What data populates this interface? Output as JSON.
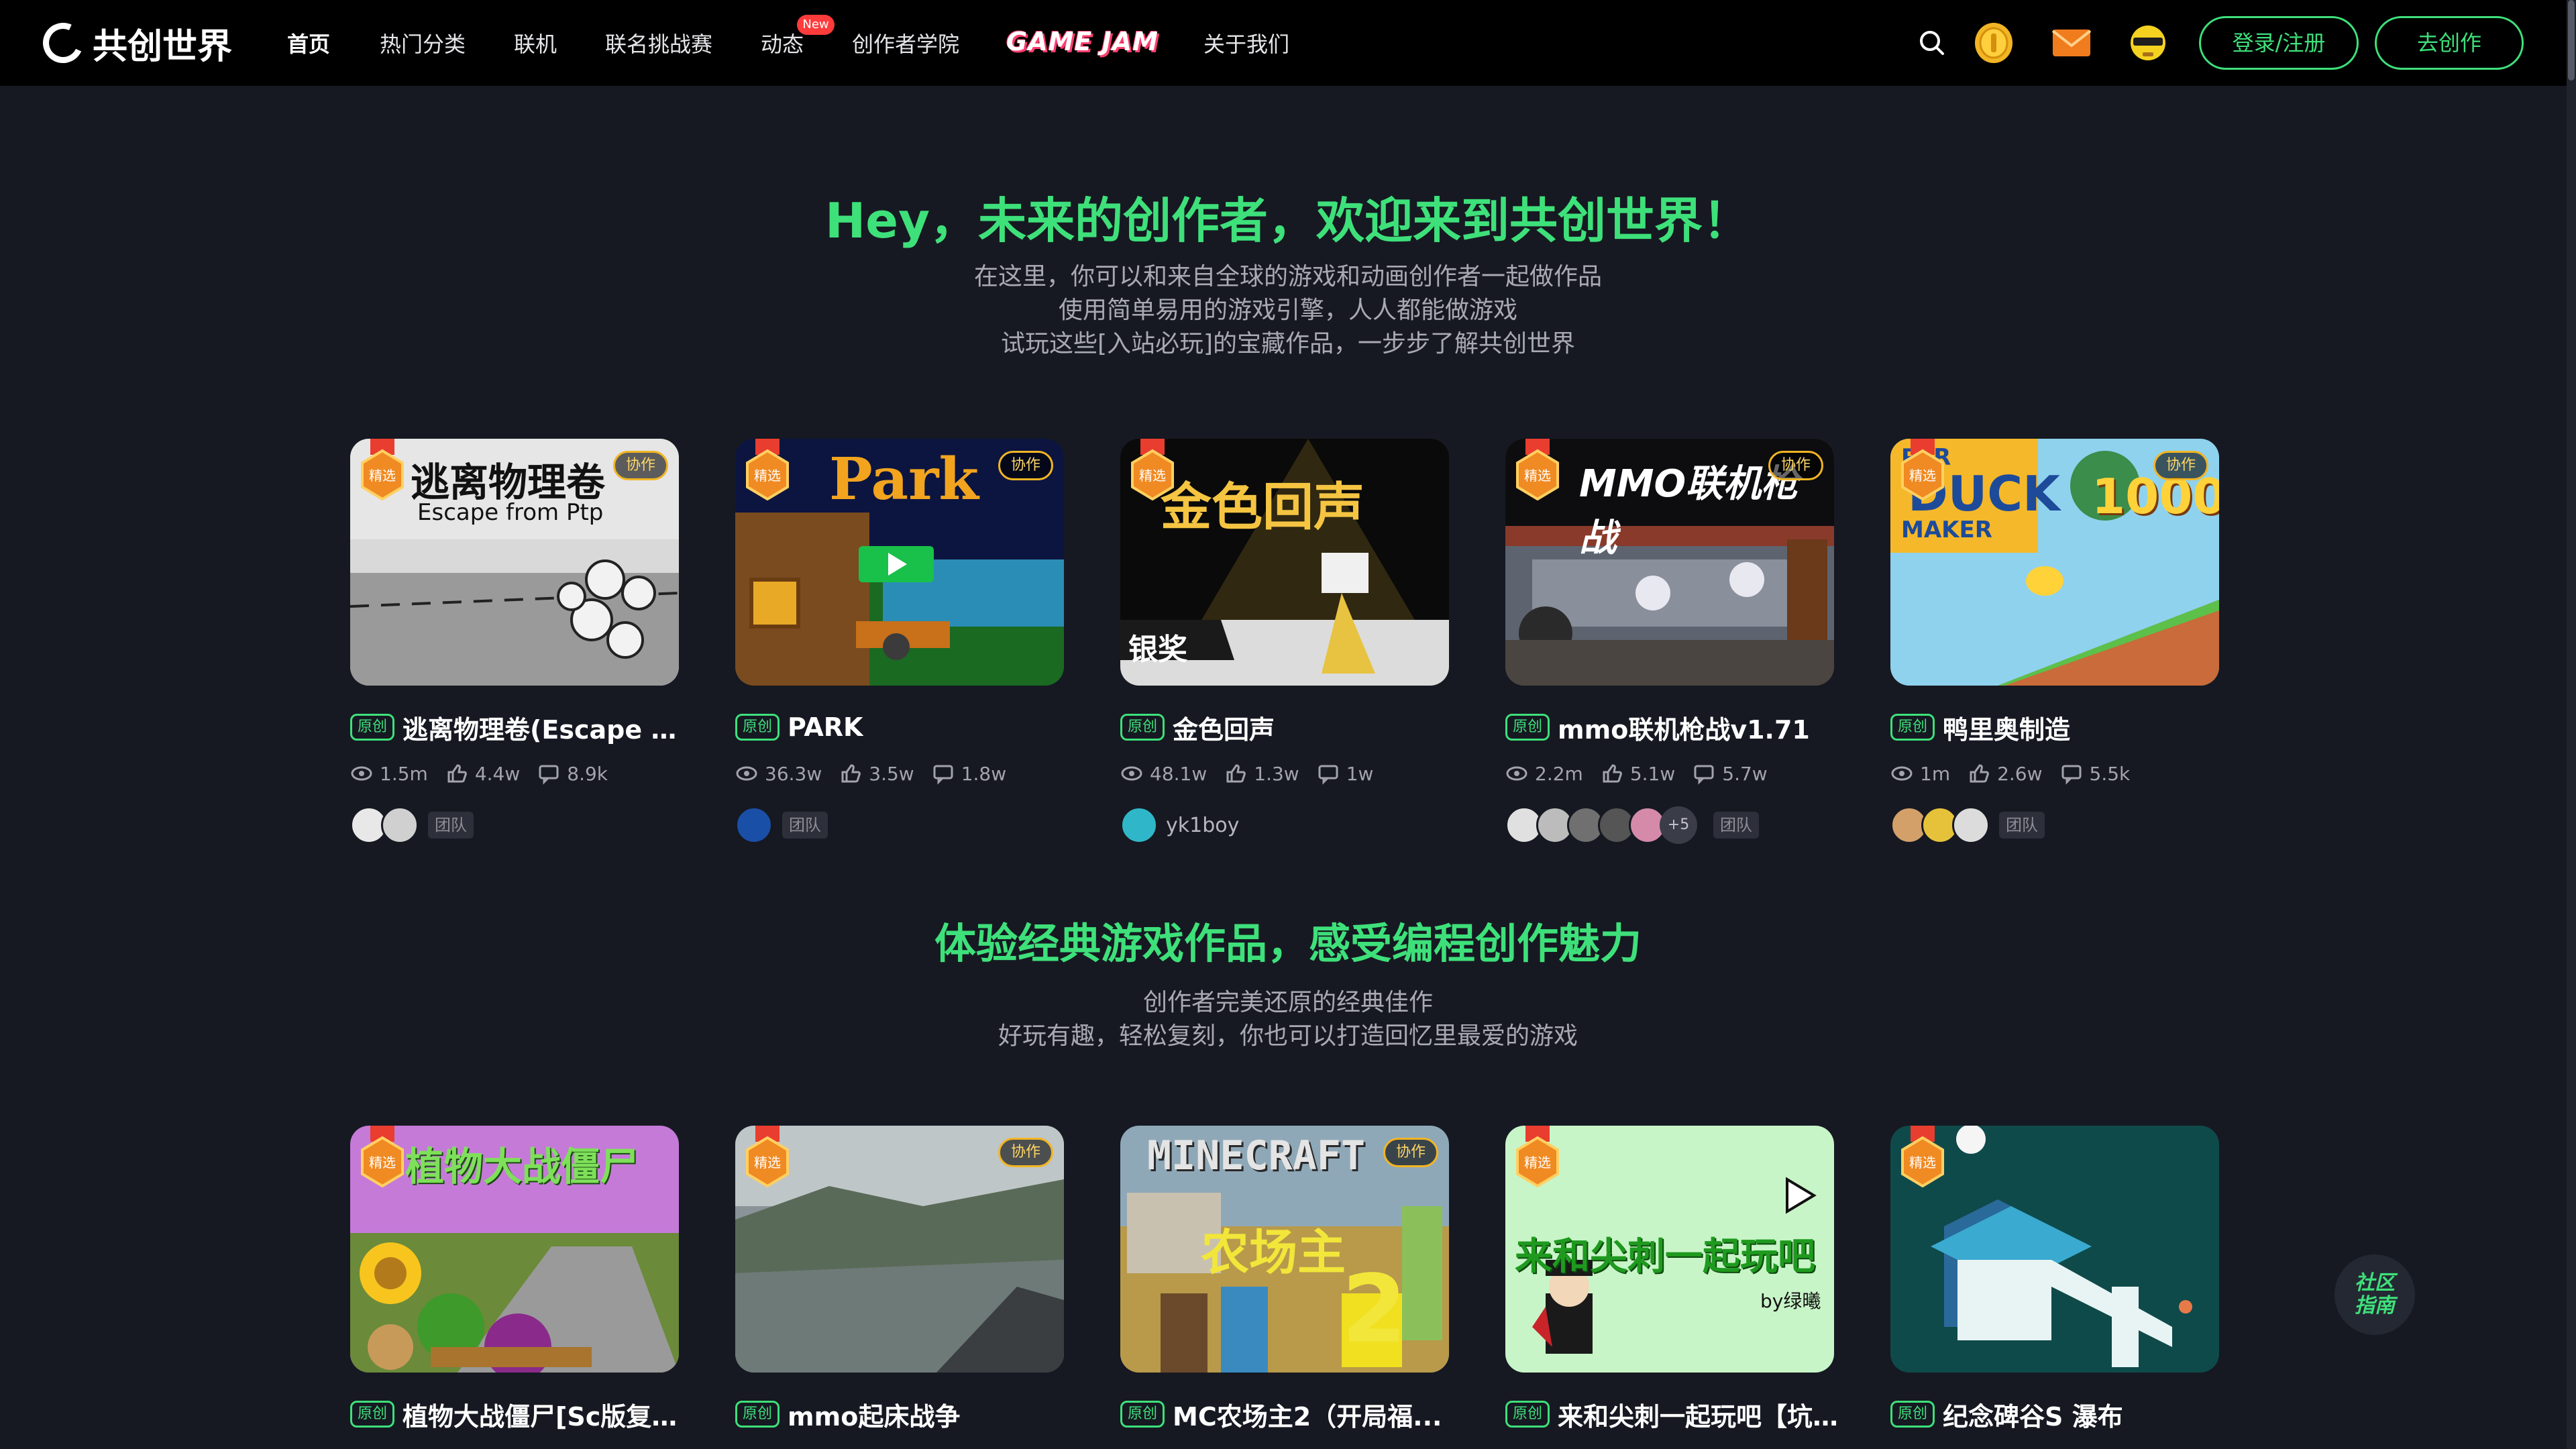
{
  "brand": {
    "logo_text": "共创世界"
  },
  "nav": {
    "items": [
      "首页",
      "热门分类",
      "联机",
      "联名挑战赛",
      "动态",
      "创作者学院",
      "关于我们"
    ],
    "new_badge": "New",
    "gamejam": "GAME JAM",
    "login_label": "登录/注册",
    "create_label": "去创作"
  },
  "hero": {
    "title": "Hey，未来的创作者，欢迎来到共创世界！",
    "lines": [
      "在这里，你可以和来自全球的游戏和动画创作者一起做作品",
      "使用简单易用的游戏引擎，人人都能做游戏",
      "试玩这些[入站必玩]的宝藏作品，一步步了解共创世界"
    ]
  },
  "row1": [
    {
      "title": "逃离物理卷(Escape fr...",
      "tag": "原创",
      "featured": true,
      "coop": "协作",
      "views": "1.5m",
      "likes": "4.4w",
      "comments": "8.9k",
      "team": "团队",
      "thumb_title": "逃离物理卷",
      "thumb_sub": "Escape from Ptp"
    },
    {
      "title": "PARK",
      "tag": "原创",
      "featured": true,
      "coop": "协作",
      "views": "36.3w",
      "likes": "3.5w",
      "comments": "1.8w",
      "team": "团队",
      "thumb_title": "Park"
    },
    {
      "title": "金色回声",
      "tag": "原创",
      "featured": true,
      "views": "48.1w",
      "likes": "1.3w",
      "comments": "1w",
      "author": "yk1boy",
      "thumb_title": "金色回声",
      "thumb_award": "银奖"
    },
    {
      "title": "mmo联机枪战v1.71",
      "tag": "原创",
      "featured": true,
      "coop": "协作",
      "views": "2.2m",
      "likes": "5.1w",
      "comments": "5.7w",
      "team": "团队",
      "more": "+5",
      "thumb_title": "MMO联机枪战"
    },
    {
      "title": "鸭里奥制造",
      "tag": "原创",
      "featured": true,
      "coop": "协作",
      "views": "1m",
      "likes": "2.6w",
      "comments": "5.5k",
      "team": "团队",
      "thumb_title": "DUCK",
      "thumb_top": "PER",
      "thumb_bottom": "MAKER",
      "thumb_number": "1000"
    }
  ],
  "section2": {
    "title": "体验经典游戏作品，感受编程创作魅力",
    "lines": [
      "创作者完美还原的经典佳作",
      "好玩有趣，轻松复刻，你也可以打造回忆里最爱的游戏"
    ]
  },
  "row2": [
    {
      "title": "植物大战僵尸[Sc版复刻]",
      "tag": "原创",
      "featured": true,
      "thumb_title": "植物大战僵尸"
    },
    {
      "title": "mmo起床战争",
      "tag": "原创",
      "featured": true,
      "coop": "协作"
    },
    {
      "title": "MC农场主2（开局福...",
      "tag": "原创",
      "coop": "协作",
      "thumb_title": "MINECRAFT",
      "thumb_sub": "农场主",
      "thumb_num": "2"
    },
    {
      "title": "来和尖刺一起玩吧【坑...",
      "tag": "原创",
      "featured": true,
      "thumb_title": "来和尖刺一起玩吧",
      "thumb_sub": "by绿曦"
    },
    {
      "title": "纪念碑谷S 瀑布",
      "tag": "原创",
      "featured": true
    }
  ],
  "featured_label": "精选",
  "community": {
    "line1": "社区",
    "line2": "指南"
  },
  "colors": {
    "accent": "#3ee07a",
    "bg": "#161922",
    "topbar": "#000000",
    "gold": "#f2b523"
  }
}
